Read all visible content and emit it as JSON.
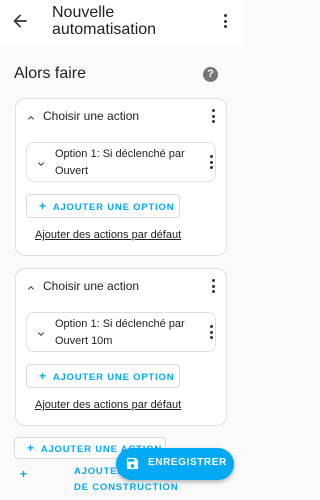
{
  "header": {
    "title": "Nouvelle automatisation",
    "back_icon": "arrow-left-icon",
    "menu_icon": "dots-vertical-icon"
  },
  "section": {
    "title": "Alors faire",
    "help_icon": "help-circle-icon",
    "help_glyph": "?"
  },
  "cards": [
    {
      "title": "Choisir une action",
      "option_label": "Option 1: Si déclenché par Ouvert",
      "add_option": "AJOUTER UNE OPTION",
      "default_actions": "Ajouter des actions par défaut"
    },
    {
      "title": "Choisir une action",
      "option_label": "Option 1: Si déclenché par Ouvert 10m",
      "add_option": "AJOUTER UNE OPTION",
      "default_actions": "Ajouter des actions par défaut"
    }
  ],
  "footer": {
    "add_action": "AJOUTER UNE ACTION",
    "add_block": "AJOUTER UN BLOC DE CONSTRUCTION",
    "save": "ENREGISTRER",
    "save_icon": "content-save-icon"
  },
  "colors": {
    "accent": "#03a9f4",
    "background": "#fafafa",
    "card": "#ffffff",
    "border": "#e0e0e0",
    "text": "#212121"
  }
}
